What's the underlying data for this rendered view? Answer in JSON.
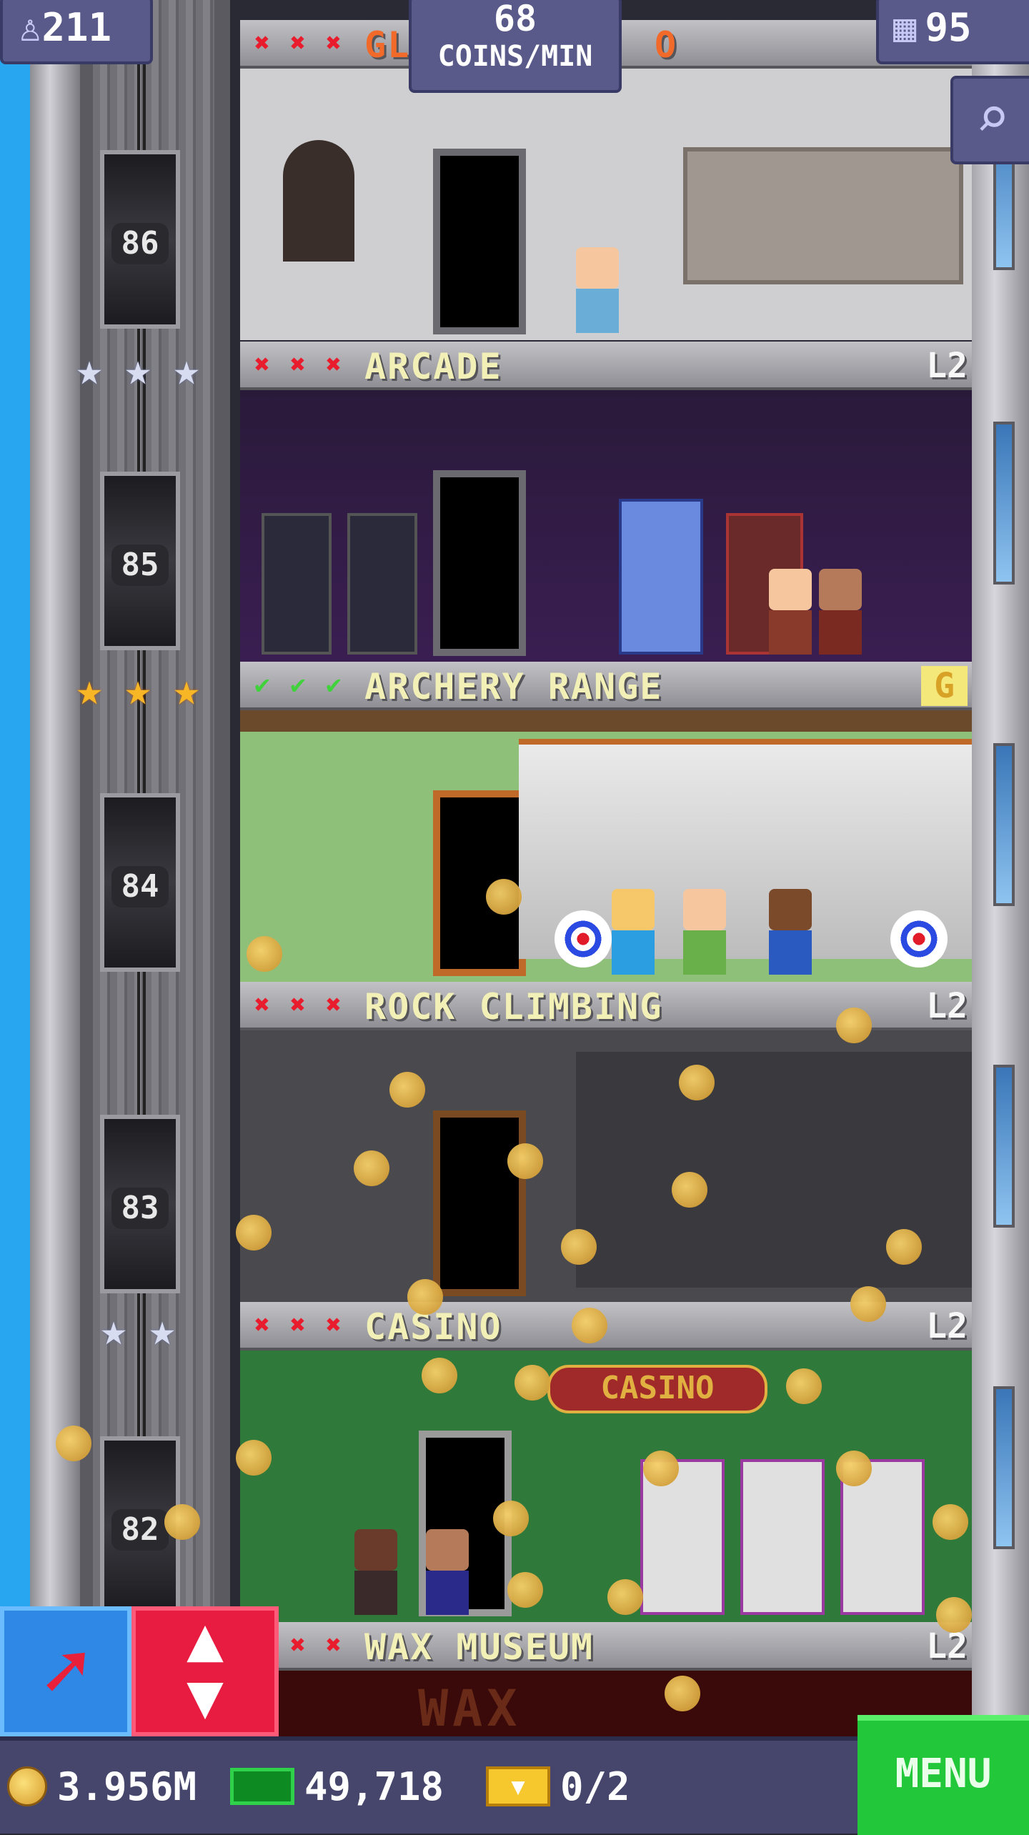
{
  "hud": {
    "population": "211",
    "coins_rate_value": "68",
    "coins_rate_label": "COINS/MIN",
    "floors_count": "95",
    "coins": "3.956M",
    "bux": "49,718",
    "tickets": "0/2",
    "menu_label": "MENU"
  },
  "elevator": {
    "floors": [
      "86",
      "85",
      "84",
      "83",
      "82"
    ]
  },
  "floors": [
    {
      "name": "GL",
      "marks": [
        "x",
        "x",
        "x"
      ],
      "level": "",
      "partial_suffix": "O"
    },
    {
      "name": "ARCADE",
      "marks": [
        "x",
        "x",
        "x"
      ],
      "level": "L2",
      "stars": 3,
      "star_color": "silver"
    },
    {
      "name": "ARCHERY RANGE",
      "marks": [
        "check",
        "check",
        "check"
      ],
      "level": "G",
      "stars": 3,
      "star_color": "gold"
    },
    {
      "name": "ROCK CLIMBING",
      "marks": [
        "x",
        "x",
        "x"
      ],
      "level": "L2"
    },
    {
      "name": "CASINO",
      "marks": [
        "x",
        "x",
        "x"
      ],
      "level": "L2",
      "stars": 2,
      "star_color": "silver"
    },
    {
      "name": "WAX MUSEUM",
      "marks": [
        "x",
        "x",
        "x"
      ],
      "level": "L2"
    }
  ],
  "signs": {
    "casino_sign": "CASINO",
    "wax_sign": "WAX"
  },
  "icons": {
    "population": "person-icon",
    "floors": "building-icon",
    "search": "magnifier-icon",
    "arrow": "arrow-icon",
    "elevator": "up-down-icon",
    "coin": "coin-icon",
    "bux": "bux-icon",
    "ticket": "ticket-icon"
  },
  "colors": {
    "sky": "#29a6f0",
    "menu": "#23c83a",
    "elevator_button": "#e81c40",
    "arrow_button": "#2f88e6",
    "floor_text": "#f2f0b6",
    "x_mark": "#e81c2c",
    "check_mark": "#3fd23a"
  }
}
